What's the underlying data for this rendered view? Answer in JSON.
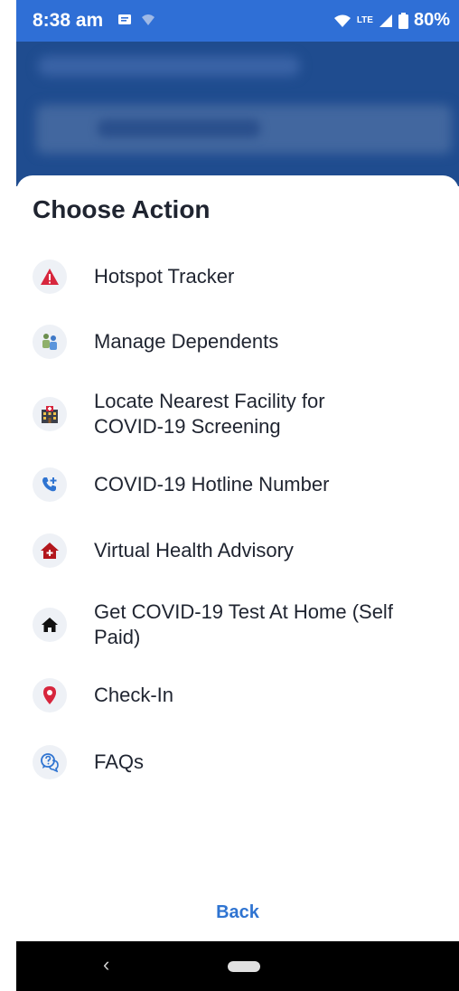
{
  "status": {
    "time": "8:38 am",
    "network": "LTE",
    "battery": "80%"
  },
  "sheet": {
    "title": "Choose Action",
    "items": [
      {
        "label_lines": [
          "Hotspot Tracker"
        ],
        "icon": "warning-triangle-icon"
      },
      {
        "label_lines": [
          "Manage Dependents"
        ],
        "icon": "people-icon"
      },
      {
        "label_lines": [
          "Locate Nearest Facility for",
          "COVID-19 Screening"
        ],
        "icon": "hospital-icon"
      },
      {
        "label_lines": [
          "COVID-19 Hotline Number"
        ],
        "icon": "phone-icon"
      },
      {
        "label_lines": [
          "Virtual Health Advisory"
        ],
        "icon": "home-health-icon"
      },
      {
        "label_lines": [
          "Get COVID-19 Test At Home (Self",
          "Paid)"
        ],
        "icon": "home-icon"
      },
      {
        "label_lines": [
          "Check-In"
        ],
        "icon": "location-pin-icon"
      },
      {
        "label_lines": [
          "FAQs"
        ],
        "icon": "faq-chat-icon"
      }
    ],
    "back_label": "Back"
  },
  "colors": {
    "status_bar": "#2f6fd6",
    "accent": "#2f74d1",
    "alert_red": "#d7263d"
  }
}
